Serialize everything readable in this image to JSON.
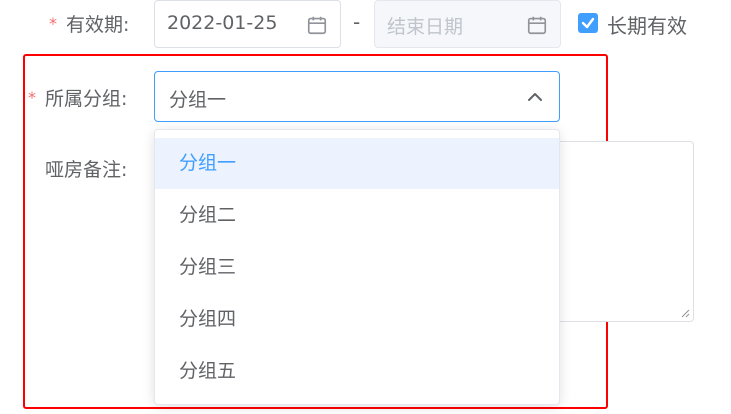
{
  "form": {
    "validity": {
      "required_mark": "*",
      "label": "有效期:",
      "start_date": "2022-01-25",
      "end_placeholder": "结束日期",
      "separator": "-",
      "long_term": {
        "label": "长期有效",
        "checked": true
      }
    },
    "group": {
      "required_mark": "*",
      "label": "所属分组:",
      "selected_value": "分组一",
      "options": [
        "分组一",
        "分组二",
        "分组三",
        "分组四",
        "分组五"
      ],
      "highlighted_index": 0
    },
    "remark": {
      "label": "哑房备注:"
    }
  },
  "colors": {
    "primary": "#409eff",
    "required": "#f56c6c",
    "highlight_box": "#ff0000",
    "selected_option_bg": "#ecf3ff"
  }
}
